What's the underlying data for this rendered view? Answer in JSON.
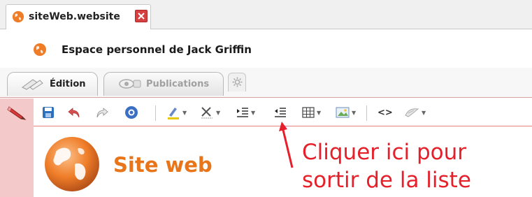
{
  "window": {
    "tab_title": "siteWeb.website"
  },
  "header": {
    "space_title": "Espace personnel de Jack Griffin"
  },
  "subtabs": [
    {
      "label": "Édition",
      "active": true
    },
    {
      "label": "Publications",
      "active": false
    }
  ],
  "toolbar": {
    "code_label": "<>",
    "items": [
      "save-icon",
      "undo-icon",
      "redo-icon",
      "help-icon",
      "highlight-icon",
      "clear-format-icon",
      "indent-icon",
      "outdent-icon",
      "table-icon",
      "image-icon",
      "code-icon",
      "clean-icon"
    ]
  },
  "content": {
    "site_name": "Site web"
  },
  "annotation": {
    "line1": "Cliquer ici pour",
    "line2": "sortir de la liste"
  },
  "colors": {
    "accent_orange": "#e8751a",
    "annotation_red": "#e6202a",
    "side_strip": "#f4c9c9"
  }
}
